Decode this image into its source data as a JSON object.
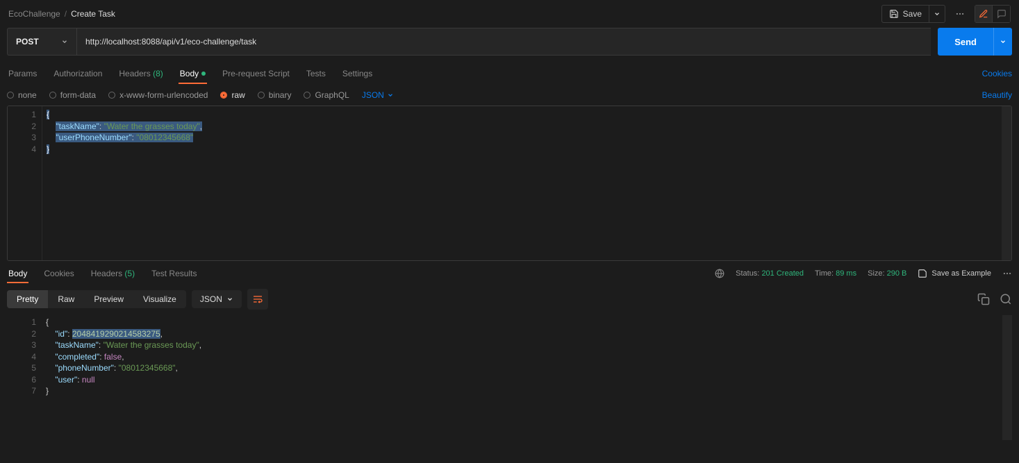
{
  "breadcrumb": {
    "workspace": "EcoChallenge",
    "current": "Create Task"
  },
  "topbar": {
    "save": "Save"
  },
  "request": {
    "method": "POST",
    "url": "http://localhost:8088/api/v1/eco-challenge/task",
    "send": "Send",
    "tabs": {
      "params": "Params",
      "auth": "Authorization",
      "headers": "Headers",
      "headers_count": "(8)",
      "body": "Body",
      "prerequest": "Pre-request Script",
      "tests": "Tests",
      "settings": "Settings",
      "cookies": "Cookies"
    },
    "body_opts": {
      "none": "none",
      "formdata": "form-data",
      "xwww": "x-www-form-urlencoded",
      "raw": "raw",
      "binary": "binary",
      "graphql": "GraphQL",
      "json": "JSON",
      "beautify": "Beautify"
    },
    "body_json": {
      "taskName_key": "\"taskName\"",
      "taskName_val": "\"Water the grasses today\"",
      "userPhone_key": "\"userPhoneNumber\"",
      "userPhone_val": "\"08012345668\""
    }
  },
  "response": {
    "tabs": {
      "body": "Body",
      "cookies": "Cookies",
      "headers": "Headers",
      "headers_count": "(5)",
      "tests": "Test Results"
    },
    "meta": {
      "status_label": "Status:",
      "status": "201 Created",
      "time_label": "Time:",
      "time": "89 ms",
      "size_label": "Size:",
      "size": "290 B",
      "save_example": "Save as Example"
    },
    "subtabs": {
      "pretty": "Pretty",
      "raw": "Raw",
      "preview": "Preview",
      "visualize": "Visualize",
      "json": "JSON"
    },
    "json": {
      "id_key": "\"id\"",
      "id_val": "2048419290214583275",
      "taskName_key": "\"taskName\"",
      "taskName_val": "\"Water the grasses today\"",
      "completed_key": "\"completed\"",
      "completed_val": "false",
      "phone_key": "\"phoneNumber\"",
      "phone_val": "\"08012345668\"",
      "user_key": "\"user\"",
      "user_val": "null"
    }
  }
}
